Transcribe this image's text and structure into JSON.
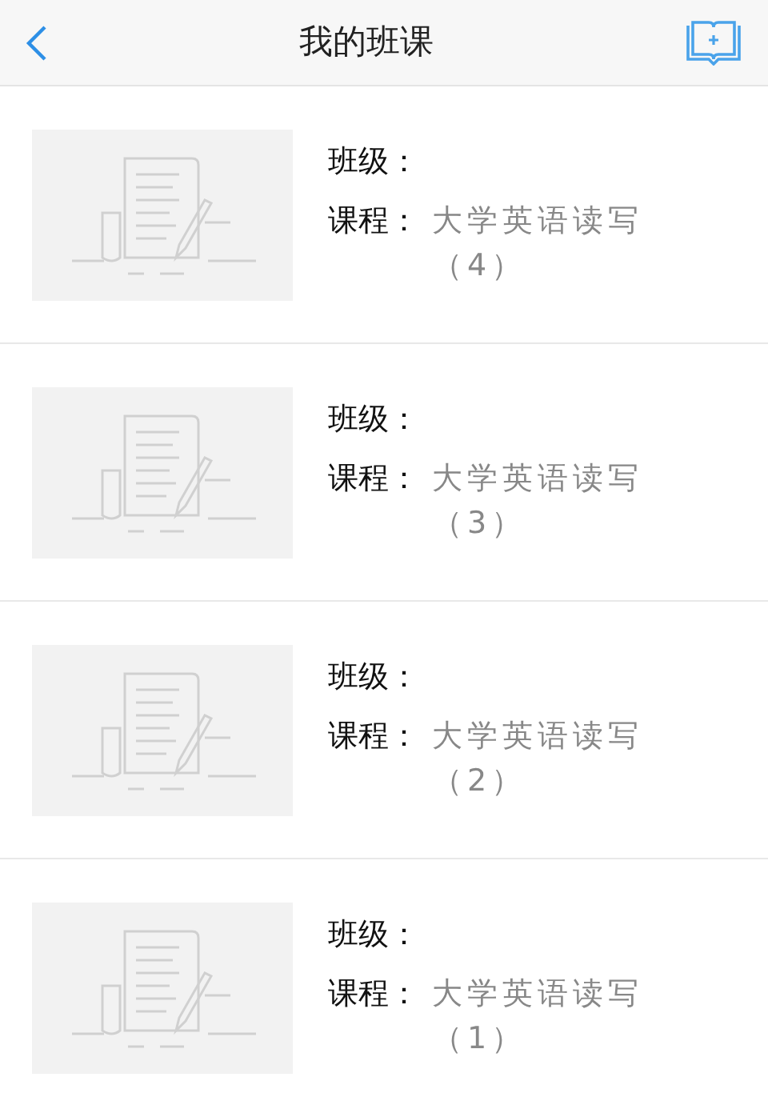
{
  "header": {
    "title": "我的班课"
  },
  "courses": [
    {
      "class_label": "班级：",
      "course_label": "课程：",
      "course_name": "大学英语读写（4）"
    },
    {
      "class_label": "班级：",
      "course_label": "课程：",
      "course_name": "大学英语读写（3）"
    },
    {
      "class_label": "班级：",
      "course_label": "课程：",
      "course_name": "大学英语读写（2）"
    },
    {
      "class_label": "班级：",
      "course_label": "课程：",
      "course_name": "大学英语读写（1）"
    }
  ]
}
